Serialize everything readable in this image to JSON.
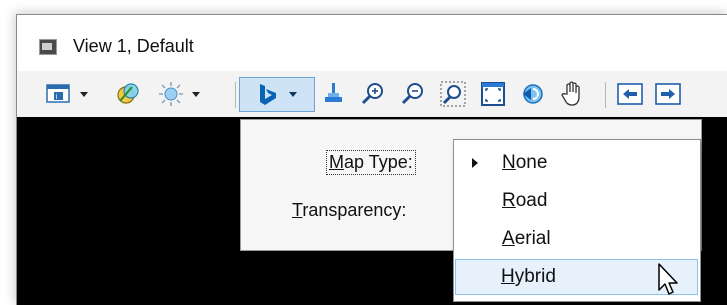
{
  "window": {
    "title": "View 1, Default"
  },
  "toolbar": {
    "buttons": [
      {
        "name": "view-attributes",
        "icon": "view-attributes-icon"
      },
      {
        "name": "display-styles",
        "icon": "display-styles-icon"
      },
      {
        "name": "lighting",
        "icon": "sun-icon"
      },
      {
        "name": "bing-maps",
        "icon": "bing-icon",
        "active": true
      },
      {
        "name": "clip-volume",
        "icon": "clip-icon"
      },
      {
        "name": "zoom-in",
        "icon": "zoom-in-icon"
      },
      {
        "name": "zoom-out",
        "icon": "zoom-out-icon"
      },
      {
        "name": "window-area",
        "icon": "window-area-icon"
      },
      {
        "name": "fit-view",
        "icon": "fit-view-icon"
      },
      {
        "name": "rotate-view",
        "icon": "rotate-icon"
      },
      {
        "name": "pan-view",
        "icon": "hand-icon"
      },
      {
        "name": "previous-view",
        "icon": "arrow-left-icon"
      },
      {
        "name": "next-view",
        "icon": "arrow-right-icon"
      }
    ]
  },
  "settings": {
    "map_type_label": {
      "underline": "M",
      "rest": "ap Type:"
    },
    "transparency_label": {
      "underline": "T",
      "rest": "ransparency:"
    }
  },
  "map_type_menu": {
    "selected": "None",
    "options": [
      {
        "underline": "N",
        "rest": "one",
        "checked": true
      },
      {
        "underline": "R",
        "rest": "oad",
        "checked": false
      },
      {
        "underline": "A",
        "rest": "erial",
        "checked": false
      },
      {
        "underline": "H",
        "rest": "ybrid",
        "checked": false,
        "hover": true
      }
    ]
  },
  "colors": {
    "accent": "#0078d7",
    "active_bg": "#cfe3f7",
    "hover_bg": "#e6f1fb",
    "viewport": "#000000"
  }
}
